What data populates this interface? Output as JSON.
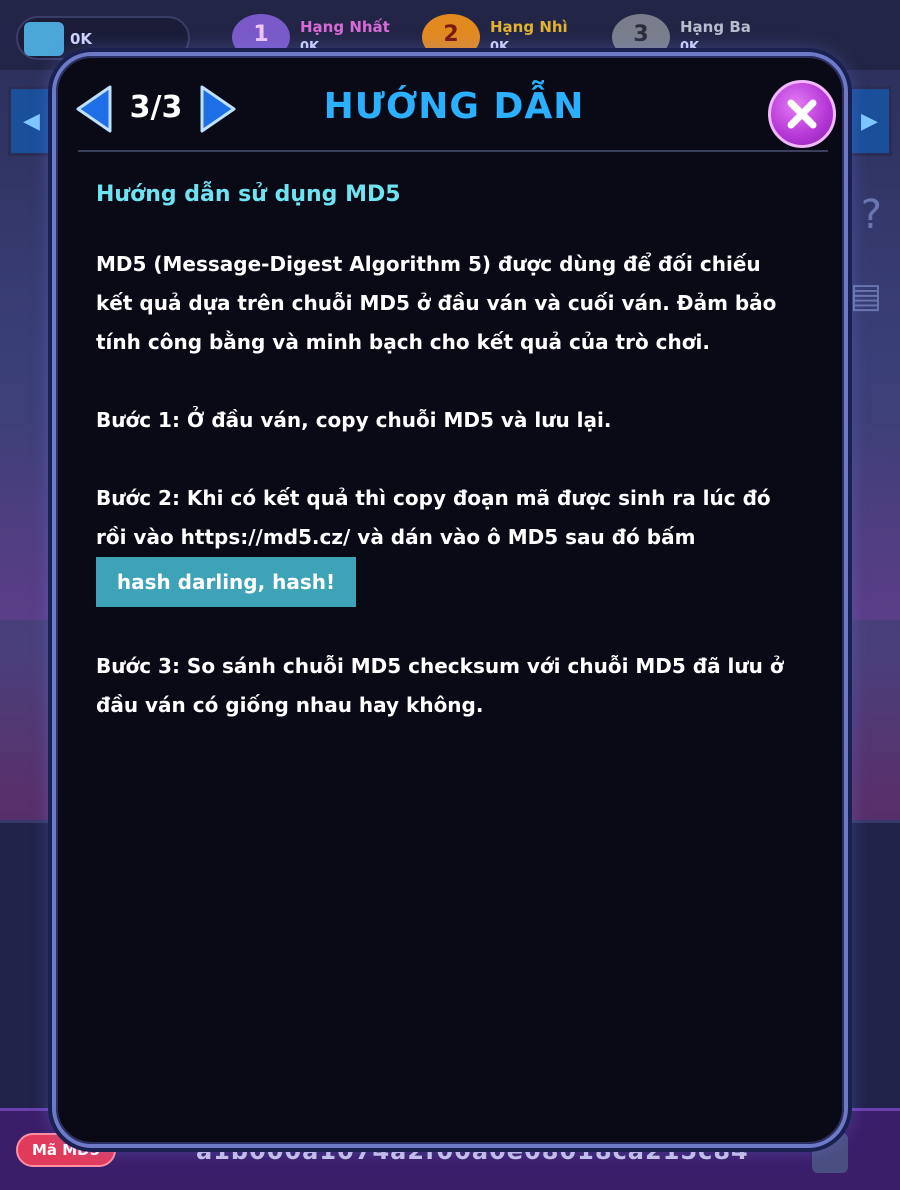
{
  "background": {
    "wallet_value": "0K",
    "ranks": [
      {
        "number": "1",
        "label": "Hạng Nhất",
        "value": "0K",
        "color": "#d86ad8",
        "medal": "#9a6ad8"
      },
      {
        "number": "2",
        "label": "Hạng Nhì",
        "value": "0K",
        "color": "#e2b230",
        "medal": "#e28a20"
      },
      {
        "number": "3",
        "label": "Hạng Ba",
        "value": "0K",
        "color": "#b8bccc",
        "medal": "#8a8e9c"
      }
    ],
    "md5_tag": "Mã MD5",
    "md5_hash": "a1b000a1074a2f00a0e08018ca215c84"
  },
  "modal": {
    "page_indicator": "3/3",
    "title": "HƯỚNG DẪN",
    "subtitle": "Hướng dẫn sử dụng MD5",
    "intro_line1": "MD5 (Message-Digest Algorithm 5) được dùng để đối chiếu",
    "intro_line2": "kết quả dựa trên chuỗi MD5 ở đầu ván và cuối ván.  Đảm bảo",
    "intro_line3": "tính công bằng và minh bạch cho kết quả của trò chơi.",
    "step1": "Bước 1: Ở đầu ván, copy chuỗi MD5 và lưu lại.",
    "step2_line1": "Bước 2: Khi có kết quả thì copy đoạn mã được sinh ra lúc đó",
    "step2_line2_pre": "rồi vào ",
    "step2_link": "https://md5.cz/",
    "step2_line2_post": " và dán vào ô MD5 sau đó bấm",
    "hash_button": "hash darling, hash!",
    "step3_line1": "Bước 3: So sánh chuỗi MD5 checksum với chuỗi MD5 đã lưu ở",
    "step3_line2": "đầu ván có giống nhau hay không."
  },
  "colors": {
    "accent_title": "#2ab0ff",
    "subtitle": "#6fe3f0",
    "close_button": "#b83ad8",
    "hash_button": "#3fa3b7"
  }
}
